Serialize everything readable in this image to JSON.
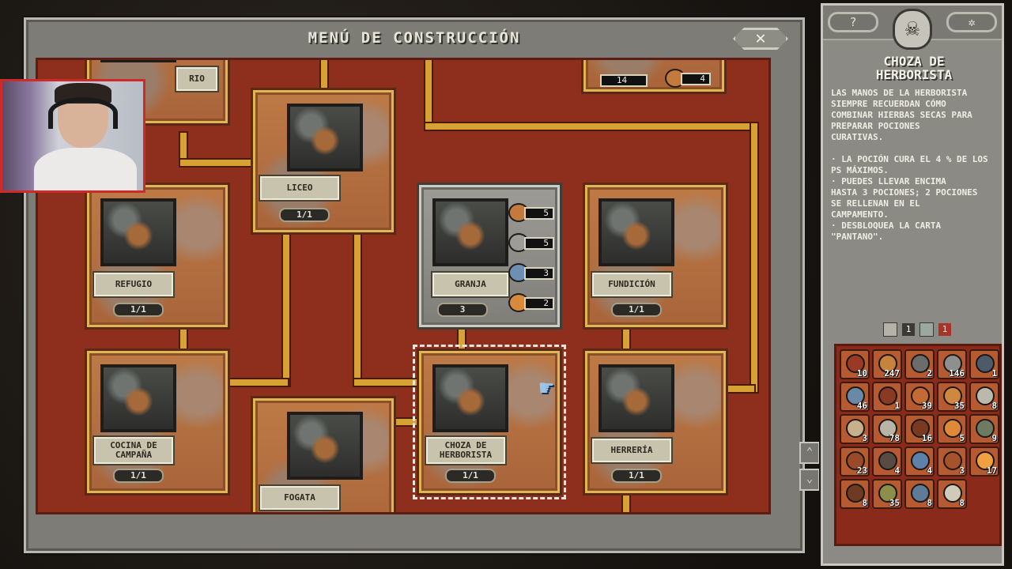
{
  "window": {
    "title": "MENÚ DE CONSTRUCCIÓN",
    "close_label": "✕"
  },
  "cards": [
    {
      "id": "top-left-partial",
      "name": "RIO",
      "count": ""
    },
    {
      "id": "liceo",
      "name": "LICEO",
      "count": "1/1"
    },
    {
      "id": "top-right-partial",
      "name": "",
      "count": ""
    },
    {
      "id": "refugio",
      "name": "REFUGIO",
      "count": "1/1"
    },
    {
      "id": "granja",
      "name": "GRANJA",
      "count": "3"
    },
    {
      "id": "fundicion",
      "name": "FUNDICIÓN",
      "count": "1/1"
    },
    {
      "id": "cocina",
      "name": "COCINA DE\nCAMPAÑA",
      "count": "1/1"
    },
    {
      "id": "fogata",
      "name": "FOGATA",
      "count": ""
    },
    {
      "id": "choza",
      "name": "CHOZA DE\nHERBORISTA",
      "count": "1/1"
    },
    {
      "id": "herreria",
      "name": "HERRERÍA",
      "count": "1/1"
    }
  ],
  "granja_costs": [
    "5",
    "5",
    "3",
    "2"
  ],
  "top_right_costs": [
    "14",
    "4"
  ],
  "scroll": {
    "up": "⌃",
    "down": "⌄"
  },
  "panel": {
    "left_btn": "?",
    "right_btn": "✲",
    "skull": "☠",
    "title": "CHOZA DE\nHERBORISTA",
    "description": "LAS MANOS DE LA HERBORISTA\nSIEMPRE RECUERDAN CÓMO\nCOMBINAR HIERBAS SECAS PARA\nPREPARAR POCIONES\nCURATIVAS.",
    "bullets": [
      "· LA POCIÓN CURA EL 4 % DE LOS\n  PS MÁXIMOS.",
      "· PUEDES LLEVAR ENCIMA\n  HASTA 3 POCIONES; 2 POCIONES\n  SE RELLENAN EN EL\n  CAMPAMENTO.",
      "· DESBLOQUEA LA CARTA\n  \"PANTANO\"."
    ],
    "filter_a": "1",
    "filter_b": "1"
  },
  "inventory": [
    {
      "q": "10",
      "c": "#9b3a24"
    },
    {
      "q": "247",
      "c": "#c7823c"
    },
    {
      "q": "2",
      "c": "#6a6d6b"
    },
    {
      "q": "146",
      "c": "#8e9090"
    },
    {
      "q": "1",
      "c": "#4d5a6a"
    },
    {
      "q": "46",
      "c": "#6a88a8"
    },
    {
      "q": "1",
      "c": "#8a3a24"
    },
    {
      "q": "39",
      "c": "#c46a34"
    },
    {
      "q": "35",
      "c": "#d08840"
    },
    {
      "q": "8",
      "c": "#bcb8ac"
    },
    {
      "q": "3",
      "c": "#c8b08a"
    },
    {
      "q": "78",
      "c": "#b9b4a4"
    },
    {
      "q": "16",
      "c": "#7a3a22"
    },
    {
      "q": "5",
      "c": "#e08a38"
    },
    {
      "q": "9",
      "c": "#6d7b62"
    },
    {
      "q": "23",
      "c": "#9a4a28"
    },
    {
      "q": "4",
      "c": "#5a4a44"
    },
    {
      "q": "4",
      "c": "#5e80aa"
    },
    {
      "q": "3",
      "c": "#a6532c"
    },
    {
      "q": "17",
      "c": "#f0a040"
    },
    {
      "q": "8",
      "c": "#6e3a22"
    },
    {
      "q": "35",
      "c": "#8b8f4a"
    },
    {
      "q": "8",
      "c": "#607a9a"
    },
    {
      "q": "8",
      "c": "#cfcbb8"
    }
  ]
}
